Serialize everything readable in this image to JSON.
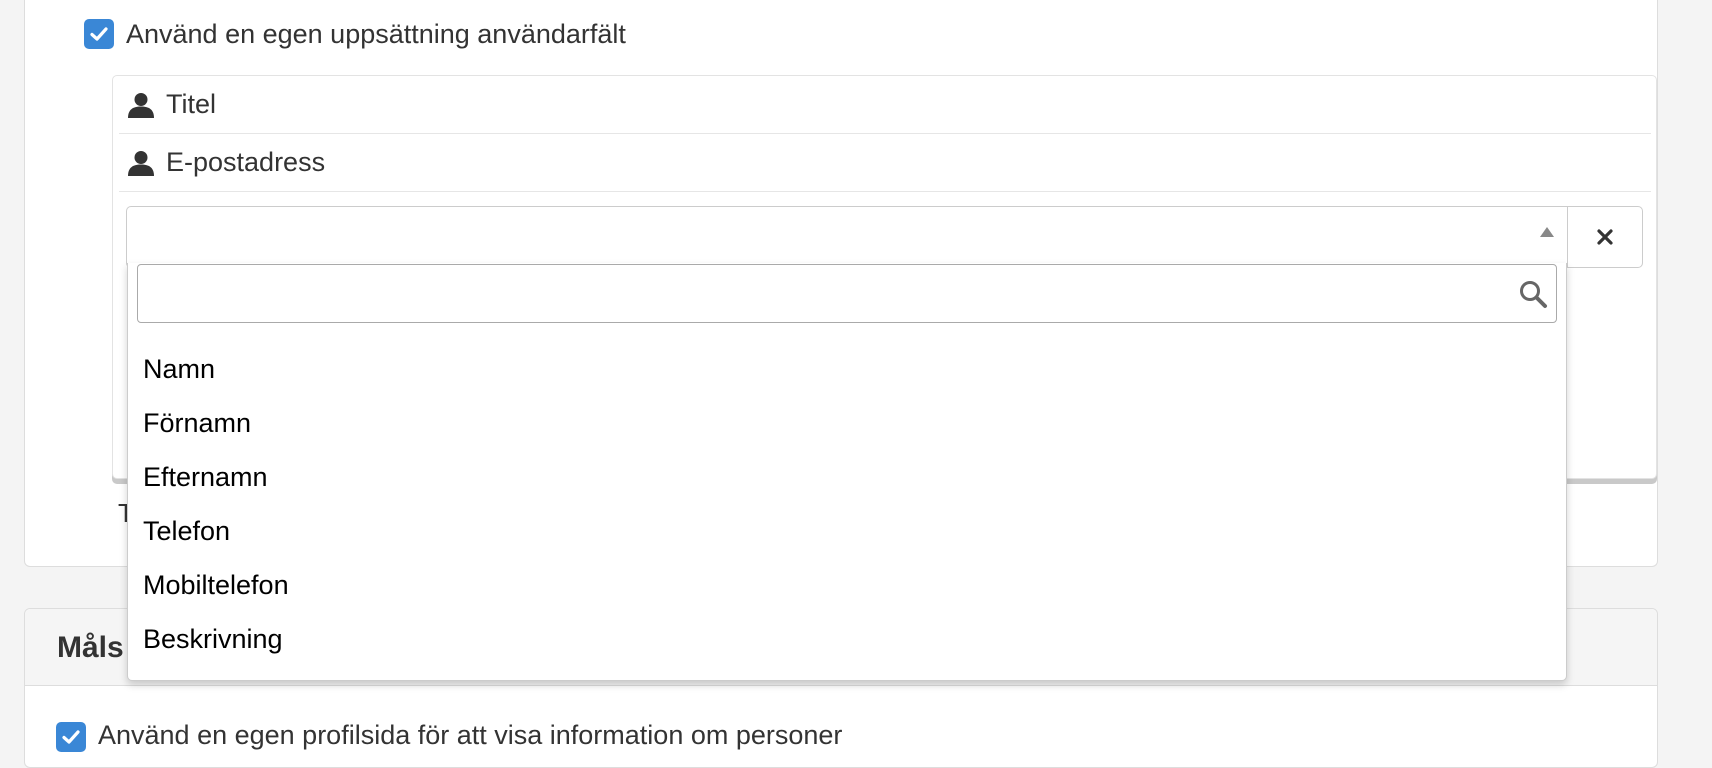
{
  "colors": {
    "checkbox": "#3a87d6",
    "border": "#cccccc",
    "panel_heading_bg": "#f5f5f5",
    "page_bg": "#f4f4f4"
  },
  "top_panel": {
    "custom_fields_checkbox": {
      "checked": true,
      "label": "Använd en egen uppsättning användarfält"
    },
    "fields": [
      {
        "icon": "user-icon",
        "label": "Titel"
      },
      {
        "icon": "user-icon",
        "label": "E-postadress"
      }
    ],
    "select": {
      "selected": "",
      "arrow_icon": "triangle-up-icon",
      "clear_icon": "close-icon"
    },
    "stray_text": "T"
  },
  "dropdown": {
    "search": {
      "value": "",
      "placeholder": "",
      "icon": "search-icon"
    },
    "options": [
      "Namn",
      "Förnamn",
      "Efternamn",
      "Telefon",
      "Mobiltelefon",
      "Beskrivning"
    ]
  },
  "bottom_panel": {
    "title": "Måls",
    "profile_checkbox": {
      "checked": true,
      "label": "Använd en egen profilsida för att visa information om personer"
    }
  }
}
